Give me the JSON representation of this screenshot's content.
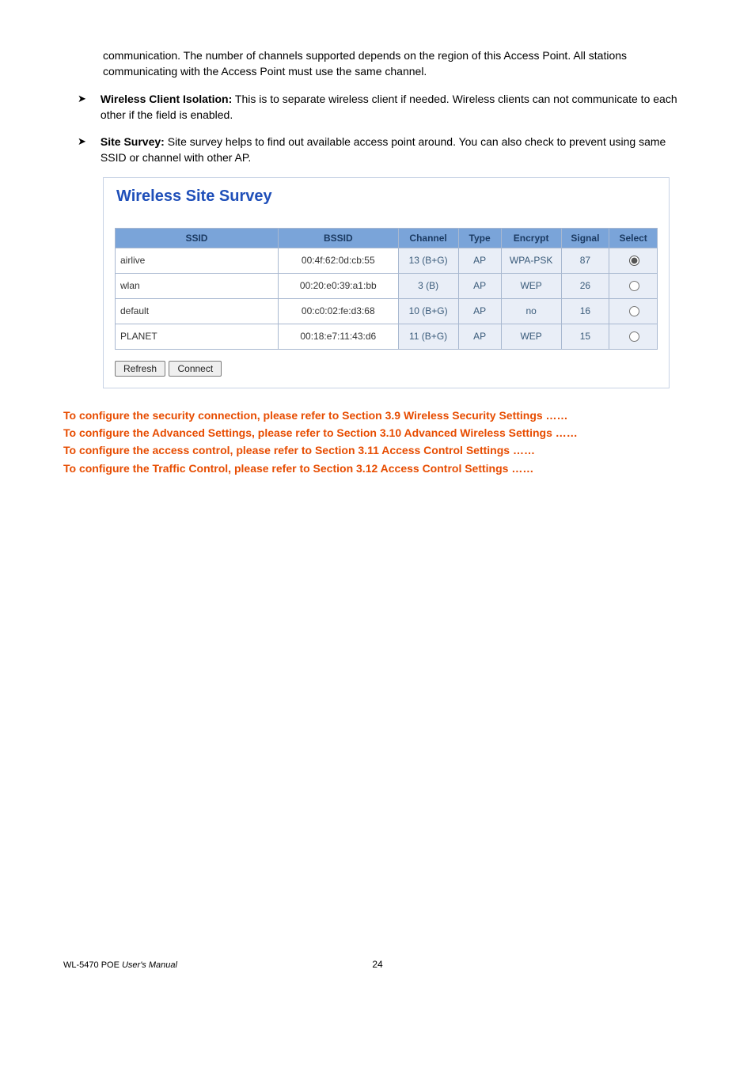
{
  "paragraphs": {
    "intro": "communication. The number of channels supported depends on the region of this Access Point. All stations communicating with the Access Point must use the same channel.",
    "bullets": [
      {
        "label": "Wireless Client Isolation:",
        "text": " This is to separate wireless client if needed. Wireless clients can not communicate to each other if the field is enabled."
      },
      {
        "label": "Site Survey:",
        "text": " Site survey helps to find out available access point around. You can also check to prevent using same SSID or channel with other AP."
      }
    ]
  },
  "survey": {
    "title": "Wireless Site Survey",
    "headers": [
      "SSID",
      "BSSID",
      "Channel",
      "Type",
      "Encrypt",
      "Signal",
      "Select"
    ],
    "rows": [
      {
        "ssid": "airlive",
        "bssid": "00:4f:62:0d:cb:55",
        "channel": "13 (B+G)",
        "type": "AP",
        "encrypt": "WPA-PSK",
        "signal": "87",
        "selected": true
      },
      {
        "ssid": "wlan",
        "bssid": "00:20:e0:39:a1:bb",
        "channel": "3 (B)",
        "type": "AP",
        "encrypt": "WEP",
        "signal": "26",
        "selected": false
      },
      {
        "ssid": "default",
        "bssid": "00:c0:02:fe:d3:68",
        "channel": "10 (B+G)",
        "type": "AP",
        "encrypt": "no",
        "signal": "16",
        "selected": false
      },
      {
        "ssid": "PLANET",
        "bssid": "00:18:e7:11:43:d6",
        "channel": "11 (B+G)",
        "type": "AP",
        "encrypt": "WEP",
        "signal": "15",
        "selected": false
      }
    ],
    "buttons": {
      "refresh": "Refresh",
      "connect": "Connect"
    }
  },
  "footnotes": [
    "To configure the security connection, please refer to Section 3.9 Wireless Security Settings ……",
    "To configure the Advanced Settings, please refer to Section 3.10 Advanced Wireless Settings ……",
    "To configure the access control, please refer to Section 3.11 Access Control Settings ……",
    "To configure the Traffic Control, please refer to Section 3.12 Access Control Settings ……"
  ],
  "footer": {
    "product_prefix": "WL-5470 POE ",
    "product_suffix": "User's Manual",
    "page": "24"
  }
}
